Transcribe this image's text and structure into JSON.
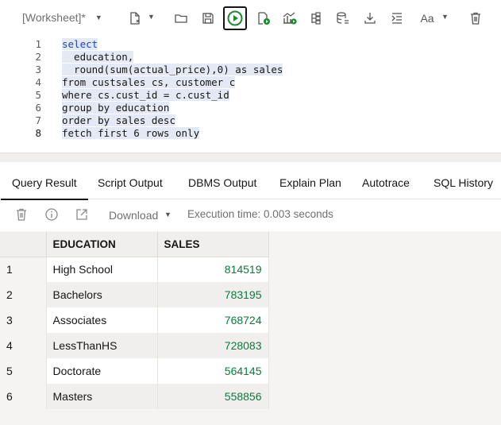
{
  "toolbar": {
    "worksheet_tab": "[Worksheet]*",
    "icons": [
      "new-file-icon",
      "open-folder-icon",
      "save-icon",
      "run-statement-icon",
      "run-script-icon",
      "explain-plan-icon",
      "autotrace-icon",
      "sql-tuning-icon",
      "download-icon",
      "format-icon",
      "font-size-icon",
      "clear-icon"
    ],
    "font_label": "Aa",
    "run_color": "#1a8a31"
  },
  "editor": {
    "lines": [
      {
        "num": "1",
        "text": "select"
      },
      {
        "num": "2",
        "text": "  education,"
      },
      {
        "num": "3",
        "text": "  round(sum(actual_price),0) as sales"
      },
      {
        "num": "4",
        "text": "from custsales cs, customer c"
      },
      {
        "num": "5",
        "text": "where cs.cust_id = c.cust_id"
      },
      {
        "num": "6",
        "text": "group by education"
      },
      {
        "num": "7",
        "text": "order by sales desc"
      },
      {
        "num": "8",
        "text": "fetch first 6 rows only"
      }
    ]
  },
  "tabs": [
    {
      "label": "Query Result",
      "active": true
    },
    {
      "label": "Script Output"
    },
    {
      "label": "DBMS Output"
    },
    {
      "label": "Explain Plan"
    },
    {
      "label": "Autotrace"
    },
    {
      "label": "SQL History"
    }
  ],
  "result_toolbar": {
    "download_label": "Download",
    "execution_time": "Execution time: 0.003 seconds"
  },
  "grid": {
    "columns": [
      "EDUCATION",
      "SALES"
    ],
    "rows": [
      {
        "n": "1",
        "education": "High School",
        "sales": "814519"
      },
      {
        "n": "2",
        "education": "Bachelors",
        "sales": "783195"
      },
      {
        "n": "3",
        "education": "Associates",
        "sales": "768724"
      },
      {
        "n": "4",
        "education": "LessThanHS",
        "sales": "728083"
      },
      {
        "n": "5",
        "education": "Doctorate",
        "sales": "564145"
      },
      {
        "n": "6",
        "education": "Masters",
        "sales": "558856"
      }
    ]
  }
}
